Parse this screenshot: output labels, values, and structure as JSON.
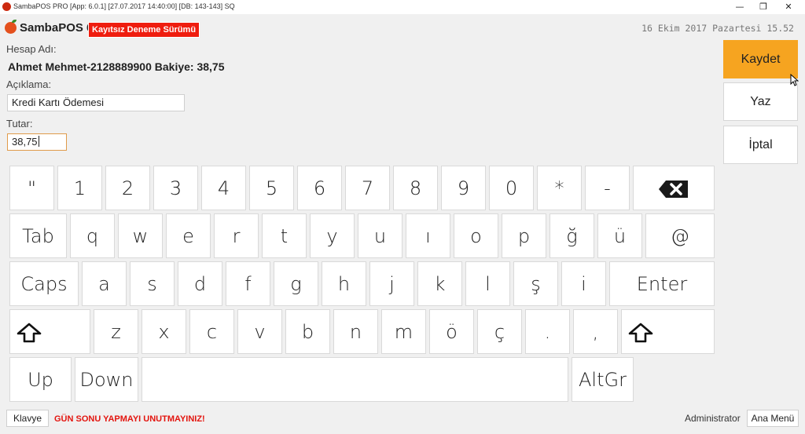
{
  "window": {
    "title": "SambaPOS PRO [App: 6.0.1] [27.07.2017 14:40:00] [DB: 143-143] SQ",
    "minimize_glyph": "—",
    "restore_glyph": "❐",
    "close_glyph": "✕"
  },
  "header": {
    "logo_text": "SambaPOS 6",
    "trial_badge": "Kayıtsız Deneme Sürümü",
    "datetime": "16 Ekim 2017 Pazartesi 15.52",
    "accent_color": "#ef1d0f"
  },
  "form": {
    "account_label": "Hesap Adı:",
    "account_value": "Ahmet Mehmet-2128889900 Bakiye: 38,75",
    "description_label": "Açıklama:",
    "description_value": "Kredi Kartı Ödemesi",
    "amount_label": "Tutar:",
    "amount_value": "38,75"
  },
  "actions": {
    "save": "Kaydet",
    "print": "Yaz",
    "cancel": "İptal",
    "save_color": "#f6a420"
  },
  "keyboard": {
    "row1": [
      "\"",
      "1",
      "2",
      "3",
      "4",
      "5",
      "6",
      "7",
      "8",
      "9",
      "0",
      "*",
      "-"
    ],
    "backspace_icon": "backspace-icon",
    "tab": "Tab",
    "row2": [
      "q",
      "w",
      "e",
      "r",
      "t",
      "y",
      "u",
      "ı",
      "o",
      "p",
      "ğ",
      "ü",
      "@"
    ],
    "caps": "Caps",
    "row3": [
      "a",
      "s",
      "d",
      "f",
      "g",
      "h",
      "j",
      "k",
      "l",
      "ş",
      "i"
    ],
    "enter": "Enter",
    "shift_icon": "shift-icon",
    "row4": [
      "z",
      "x",
      "c",
      "v",
      "b",
      "n",
      "m",
      "ö",
      "ç",
      ".",
      ","
    ],
    "up": "Up",
    "down": "Down",
    "altgr": "AltGr"
  },
  "statusbar": {
    "keyboard_button": "Klavye",
    "warning": "GÜN SONU YAPMAYI UNUTMAYINIZ!",
    "user": "Administrator",
    "main_menu": "Ana Menü",
    "warning_color": "#e3140e"
  }
}
